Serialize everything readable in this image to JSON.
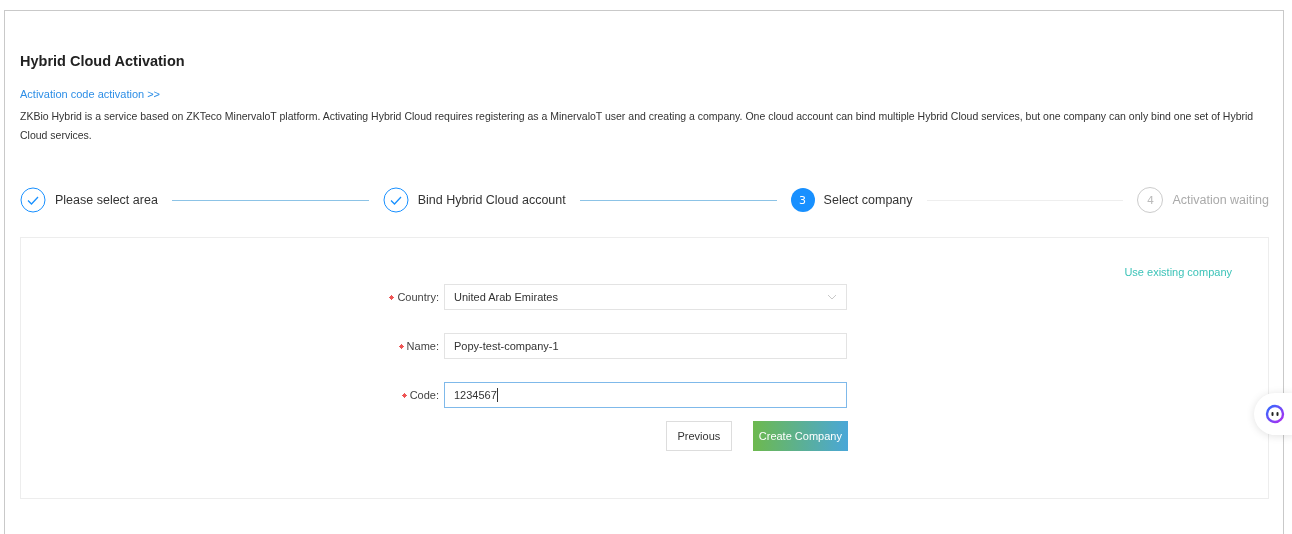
{
  "page": {
    "title": "Hybrid Cloud Activation",
    "link": "Activation code activation >>",
    "description": "ZKBio Hybrid is a service based on ZKTeco MinervaloT platform. Activating Hybrid Cloud requires registering as a MinervaloT user and creating a company. One cloud account can bind multiple Hybrid Cloud services, but one company can only bind one set of Hybrid Cloud services."
  },
  "steps": [
    {
      "label": "Please select area",
      "kind": "done"
    },
    {
      "label": "Bind Hybrid Cloud account",
      "kind": "done"
    },
    {
      "number": "3",
      "label": "Select company",
      "kind": "current"
    },
    {
      "number": "4",
      "label": "Activation waiting",
      "kind": "pending"
    }
  ],
  "form": {
    "switch_link": "Use existing company",
    "fields": [
      {
        "kind": "select",
        "required": true,
        "label": "Country:",
        "value": "United Arab Emirates",
        "focused": false
      },
      {
        "kind": "text",
        "required": true,
        "label": "Name:",
        "value": "Popy-test-company-1",
        "focused": false
      },
      {
        "kind": "text",
        "required": true,
        "label": "Code:",
        "value": "1234567",
        "focused": true
      }
    ],
    "buttons": [
      {
        "kind": "secondary",
        "label": "Previous"
      },
      {
        "kind": "primary",
        "label": "Create Company"
      }
    ]
  }
}
